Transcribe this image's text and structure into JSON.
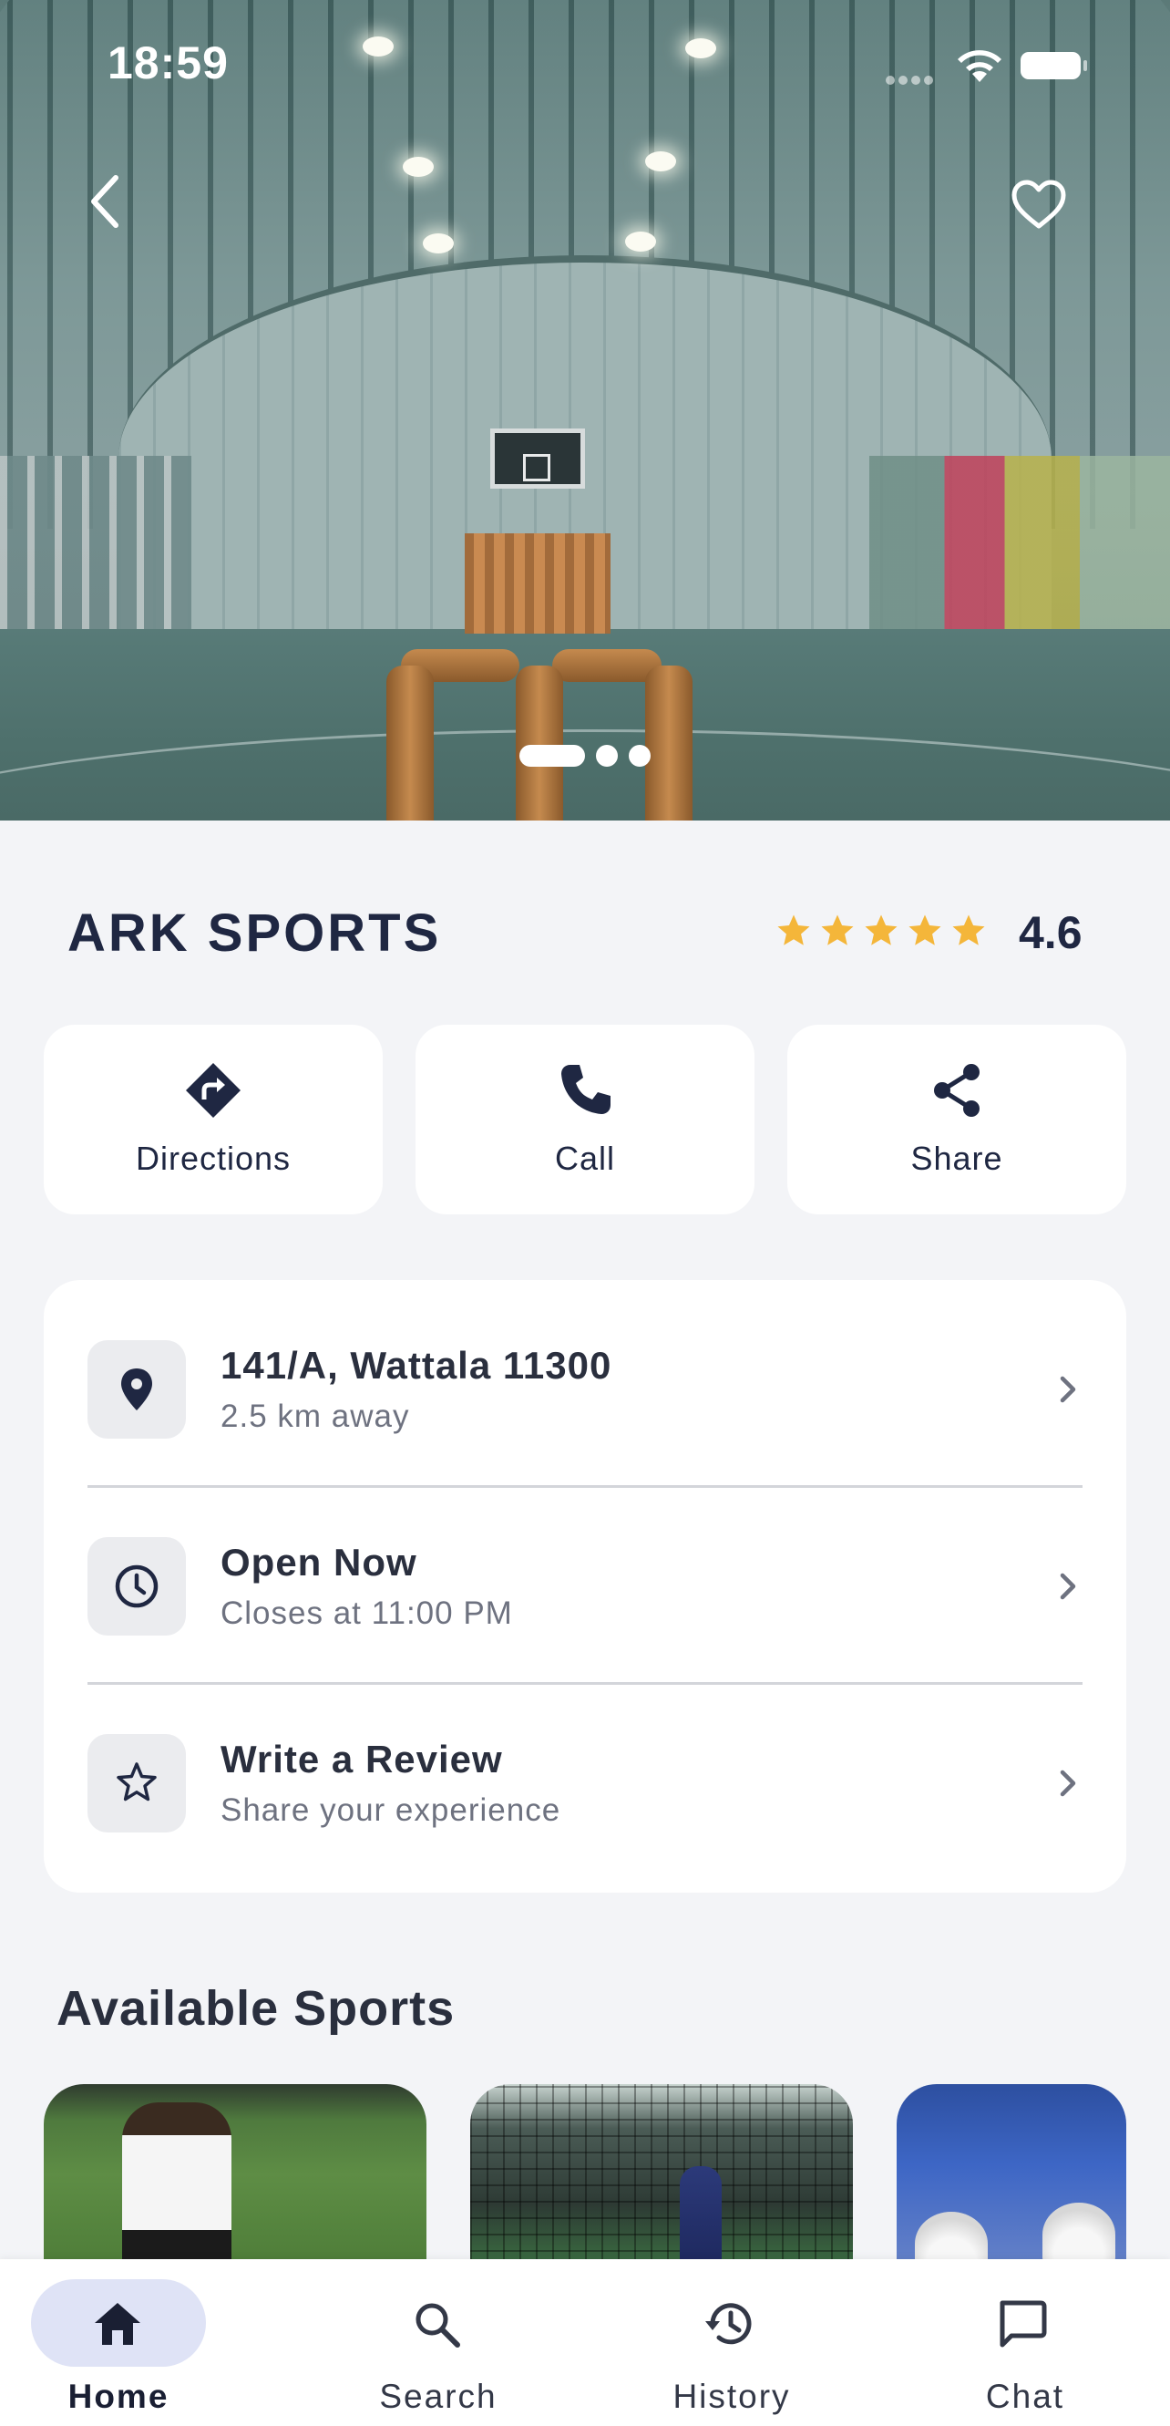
{
  "status_bar": {
    "time": "18:59"
  },
  "hero": {
    "page_count": 3,
    "active_page": 1
  },
  "venue": {
    "name": "ARK SPORTS",
    "rating": "4.6",
    "stars": 5,
    "star_color": "#f4b63a"
  },
  "actions": [
    {
      "label": "Directions",
      "icon": "directions-icon"
    },
    {
      "label": "Call",
      "icon": "phone-icon"
    },
    {
      "label": "Share",
      "icon": "share-icon"
    }
  ],
  "info": {
    "address": {
      "title": "141/A, Wattala 11300",
      "subtitle": "2.5 km away"
    },
    "hours": {
      "title": "Open Now",
      "subtitle": "Closes at 11:00 PM"
    },
    "review": {
      "title": "Write a Review",
      "subtitle": "Share your experience"
    }
  },
  "sports_section": {
    "title": "Available Sports"
  },
  "nav": [
    {
      "label": "Home",
      "icon": "home-icon",
      "active": true
    },
    {
      "label": "Search",
      "icon": "search-icon",
      "active": false
    },
    {
      "label": "History",
      "icon": "history-icon",
      "active": false
    },
    {
      "label": "Chat",
      "icon": "chat-icon",
      "active": false
    }
  ],
  "colors": {
    "primary": "#1f2742",
    "background": "#f3f4f7",
    "active_nav_pill": "#dfe3f6"
  }
}
